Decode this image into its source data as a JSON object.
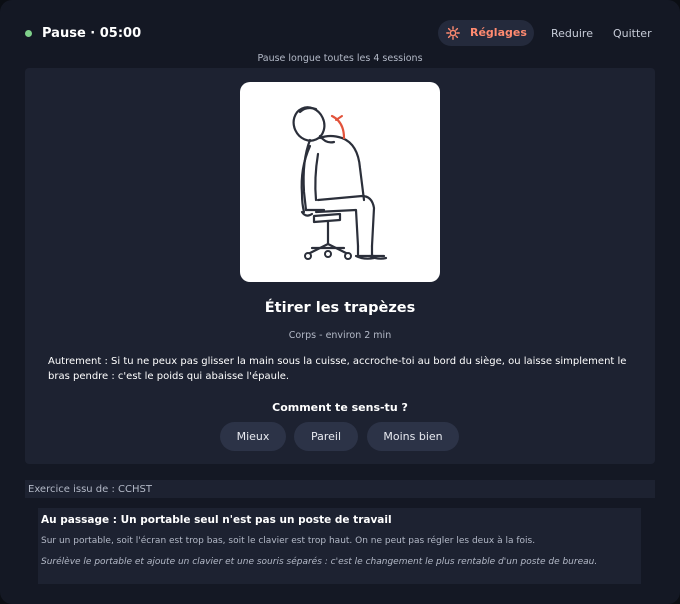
{
  "header": {
    "status_color": "#7fd08a",
    "timer": "Pause · 05:00",
    "settings_label": "Réglages",
    "settings_icon": "gear-icon",
    "reduce_label": "Reduire",
    "quit_label": "Quitter"
  },
  "subtitle": "Pause longue toutes les 4 sessions",
  "exercise": {
    "illustration": "person-seated-neck-stretch-illustration",
    "title": "Étirer les trapèzes",
    "meta": "Corps - environ 2 min",
    "description": "Autrement : Si tu ne peux pas glisser la main sous la cuisse, accroche-toi au bord du siège, ou laisse simplement le bras pendre : c'est le poids qui abaisse l'épaule."
  },
  "feedback": {
    "question": "Comment te sens-tu ?",
    "options": [
      "Mieux",
      "Pareil",
      "Moins bien"
    ]
  },
  "source": "Exercice issu de : CCHST",
  "tip": {
    "title": "Au passage : Un portable seul n'est pas un poste de travail",
    "body": "Sur un portable, soit l'écran est trop bas, soit le clavier est trop haut. On ne peut pas régler les deux à la fois.",
    "advice": "Surélève le portable et ajoute un clavier et une souris séparés : c'est le changement le plus rentable d'un poste de bureau."
  },
  "colors": {
    "background": "#141824",
    "card": "#1d2231",
    "accent": "#ff8a70",
    "button": "#2c3347"
  }
}
